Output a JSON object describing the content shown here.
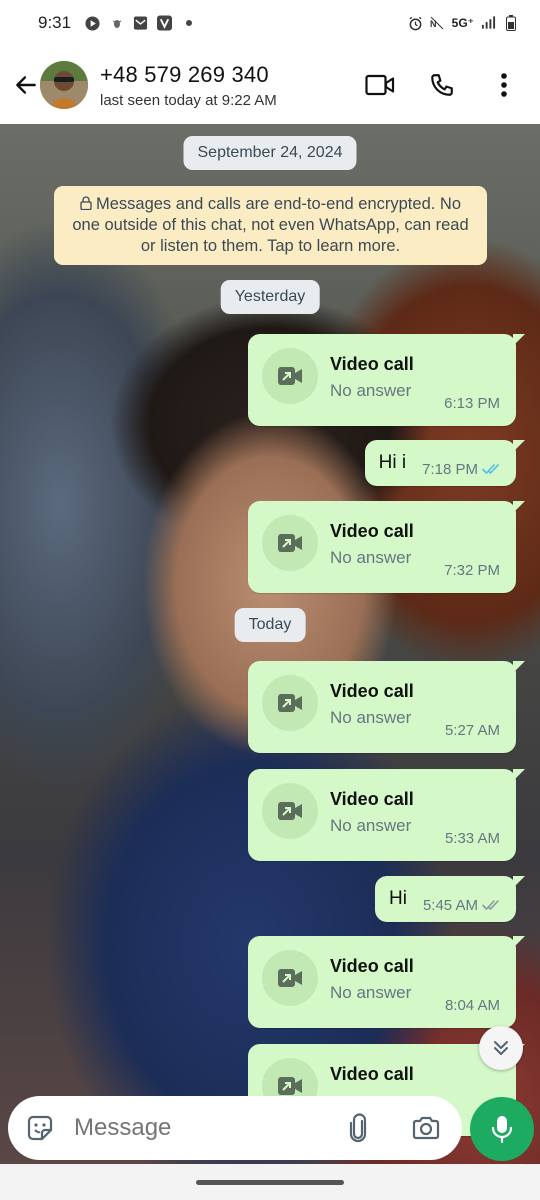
{
  "status_bar": {
    "time": "9:31",
    "network": "5G⁺"
  },
  "header": {
    "contact_name": "+48 579 269 340",
    "last_seen": "last seen today at 9:22 AM"
  },
  "chat": {
    "date_top": "September 24, 2024",
    "encryption_notice": "Messages and calls are end-to-end encrypted. No one outside of this chat, not even WhatsApp, can read or listen to them. Tap to learn more.",
    "date_yesterday": "Yesterday",
    "date_today": "Today",
    "messages": [
      {
        "type": "call",
        "title": "Video call",
        "status": "No answer",
        "time": "6:13 PM"
      },
      {
        "type": "text",
        "text": "Hi i",
        "time": "7:18 PM",
        "ticks": "read"
      },
      {
        "type": "call",
        "title": "Video call",
        "status": "No answer",
        "time": "7:32 PM"
      },
      {
        "type": "call",
        "title": "Video call",
        "status": "No answer",
        "time": "5:27 AM"
      },
      {
        "type": "call",
        "title": "Video call",
        "status": "No answer",
        "time": "5:33 AM"
      },
      {
        "type": "text",
        "text": "Hi",
        "time": "5:45 AM",
        "ticks": "delivered"
      },
      {
        "type": "call",
        "title": "Video call",
        "status": "No answer",
        "time": "8:04 AM"
      },
      {
        "type": "call",
        "title": "Video call",
        "status": "",
        "time": ""
      }
    ]
  },
  "composer": {
    "placeholder": "Message"
  },
  "colors": {
    "bubble_out": "#d4f8c8",
    "read_ticks": "#53bdeb",
    "mic_button": "#1daa61"
  }
}
